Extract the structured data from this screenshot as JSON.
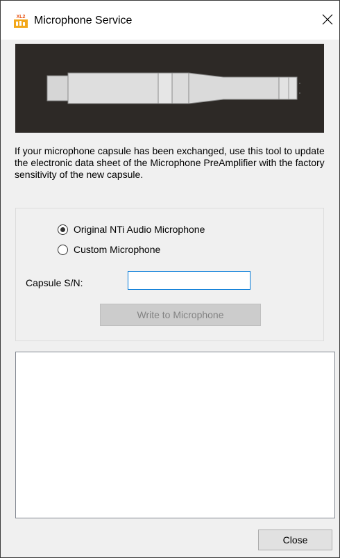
{
  "window": {
    "title": "Microphone Service",
    "icon_text": "XL2"
  },
  "description": "If your microphone capsule has been exchanged, use this tool to update the electronic data sheet of the Microphone PreAmplifier with the factory sensitivity of the new capsule.",
  "options": {
    "original_label": "Original NTi Audio Microphone",
    "custom_label": "Custom Microphone",
    "selected": "original"
  },
  "capsule": {
    "label": "Capsule S/N:",
    "value": ""
  },
  "buttons": {
    "write_label": "Write to Microphone",
    "write_enabled": false,
    "close_label": "Close"
  },
  "log": {
    "text": ""
  },
  "colors": {
    "image_background": "#2d2926",
    "input_border_focus": "#0078d7",
    "icon_orange": "#f2a71b"
  }
}
